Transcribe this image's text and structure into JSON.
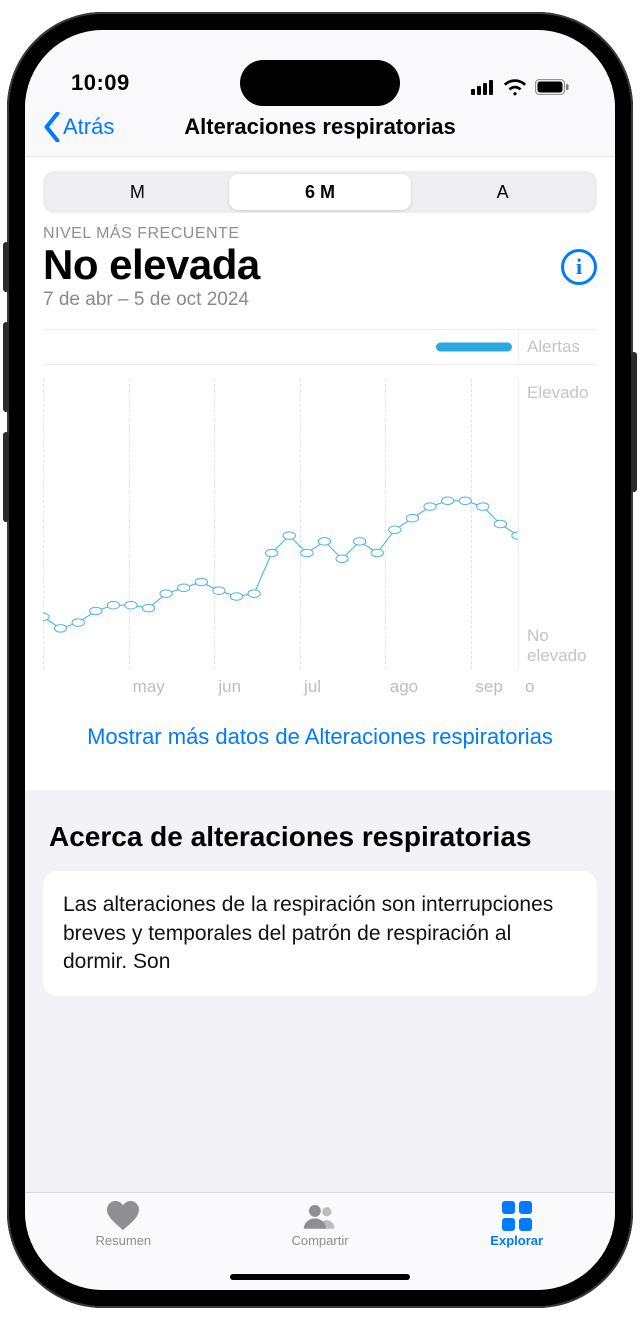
{
  "statusbar": {
    "time": "10:09"
  },
  "nav": {
    "back": "Atrás",
    "title": "Alteraciones respiratorias"
  },
  "segmented": {
    "items": [
      "M",
      "6 M",
      "A"
    ],
    "selected": 1
  },
  "summary": {
    "label": "NIVEL MÁS FRECUENTE",
    "value": "No elevada",
    "range": "7 de abr – 5 de oct 2024"
  },
  "chart_data": {
    "type": "line",
    "title": "",
    "xlabel": "",
    "ylabel": "",
    "y_categories": [
      "No elevado",
      "Elevado"
    ],
    "ylim": [
      0,
      1
    ],
    "alerts_label": "Alertas",
    "x_ticks": [
      "may",
      "jun",
      "jul",
      "ago",
      "sep",
      "o"
    ],
    "x": [
      0,
      1,
      2,
      3,
      4,
      5,
      6,
      7,
      8,
      9,
      10,
      11,
      12,
      13,
      14,
      15,
      16,
      17,
      18,
      19,
      20,
      21,
      22,
      23,
      24,
      25,
      26,
      27
    ],
    "values": [
      0.18,
      0.14,
      0.16,
      0.2,
      0.22,
      0.22,
      0.21,
      0.26,
      0.28,
      0.3,
      0.27,
      0.25,
      0.26,
      0.4,
      0.46,
      0.4,
      0.44,
      0.38,
      0.44,
      0.4,
      0.48,
      0.52,
      0.56,
      0.58,
      0.58,
      0.56,
      0.5,
      0.46
    ],
    "alerts_present_at_end": true
  },
  "links": {
    "more": "Mostrar más datos de Alteraciones respiratorias"
  },
  "about": {
    "title": "Acerca de alteraciones respiratorias",
    "body": "Las alteraciones de la respiración son interrupciones breves y temporales del patrón de respiración al dormir. Son"
  },
  "tabs": {
    "items": [
      {
        "id": "resumen",
        "label": "Resumen"
      },
      {
        "id": "compartir",
        "label": "Compartir"
      },
      {
        "id": "explorar",
        "label": "Explorar"
      }
    ],
    "active": "explorar"
  },
  "colors": {
    "accent": "#007aff",
    "chart_line": "#4db4e6"
  }
}
